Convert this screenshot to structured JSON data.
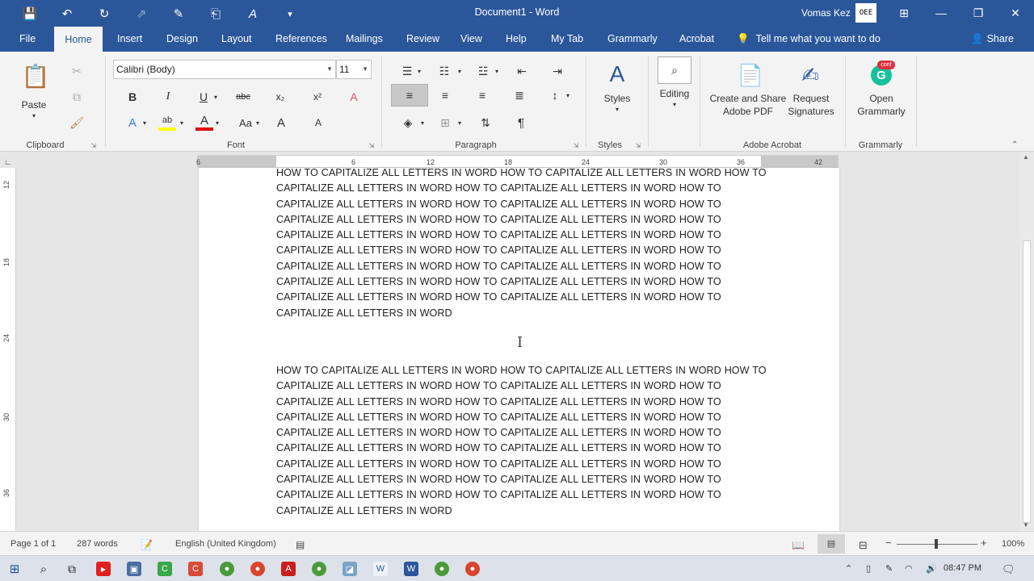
{
  "titlebar": {
    "doc_title": "Document1  -  Word",
    "user_name": "Vomas Kez",
    "avatar_text": "OEE",
    "qat_icons": [
      "save-icon",
      "undo-icon",
      "redo-icon",
      "touch-mode-icon",
      "form-icon",
      "page-icon",
      "font-color-icon",
      "customize-icon"
    ],
    "qat_glyphs": [
      "💾",
      "↶",
      "↻",
      "⇗",
      "✎",
      "⎗",
      "A",
      "▾"
    ],
    "controls": {
      "restore_ribbon": "⊞",
      "minimize": "—",
      "maximize": "❐",
      "close": "✕"
    }
  },
  "tabs": [
    {
      "label": "File"
    },
    {
      "label": "Home"
    },
    {
      "label": "Insert"
    },
    {
      "label": "Design"
    },
    {
      "label": "Layout"
    },
    {
      "label": "References"
    },
    {
      "label": "Mailings"
    },
    {
      "label": "Review"
    },
    {
      "label": "View"
    },
    {
      "label": "Help"
    },
    {
      "label": "My Tab"
    },
    {
      "label": "Grammarly"
    },
    {
      "label": "Acrobat"
    }
  ],
  "tellme": "Tell me what you want to do",
  "share": "Share",
  "ribbon": {
    "clipboard": {
      "paste": "Paste",
      "label": "Clipboard"
    },
    "font": {
      "family": "Calibri (Body)",
      "size": "11",
      "label": "Font",
      "bold": "B",
      "italic": "I",
      "underline": "U",
      "strike": "abc",
      "subscript": "x₂",
      "superscript": "x²",
      "clear": "A",
      "text_effects": "A",
      "highlight": "ab",
      "font_color": "A",
      "change_case": "Aa",
      "grow": "A",
      "shrink": "A"
    },
    "paragraph": {
      "label": "Paragraph",
      "show_marks": "¶"
    },
    "styles": {
      "button": "Styles",
      "label": "Styles"
    },
    "editing": {
      "button": "Editing"
    },
    "acrobat": {
      "create_share": "Create and Share",
      "adobe_pdf": "Adobe PDF",
      "request": "Request",
      "signatures": "Signatures",
      "label": "Adobe Acrobat"
    },
    "grammarly": {
      "open": "Open",
      "grammarly": "Grammarly",
      "label": "Grammarly",
      "badge": "conf"
    }
  },
  "ruler": {
    "h_ticks": [
      "6",
      "6",
      "12",
      "18",
      "24",
      "30",
      "36",
      "42"
    ],
    "v_ticks": [
      "12",
      "18",
      "24",
      "30",
      "36"
    ]
  },
  "document": {
    "paragraph_1": "HOW TO CAPITALIZE ALL LETTERS IN WORD  HOW TO CAPITALIZE ALL LETTERS IN WORD HOW TO CAPITALIZE ALL LETTERS IN WORD  HOW TO CAPITALIZE ALL LETTERS IN WORD HOW TO CAPITALIZE ALL LETTERS IN WORD  HOW TO CAPITALIZE ALL LETTERS IN WORD HOW TO CAPITALIZE ALL LETTERS IN WORD  HOW TO CAPITALIZE ALL LETTERS IN WORD HOW TO CAPITALIZE ALL LETTERS IN WORD HOW TO CAPITALIZE ALL LETTERS IN WORD HOW TO CAPITALIZE ALL LETTERS IN WORD  HOW TO CAPITALIZE ALL LETTERS IN WORD HOW TO CAPITALIZE ALL LETTERS IN WORD HOW TO CAPITALIZE ALL LETTERS IN WORD  HOW TO CAPITALIZE ALL LETTERS IN WORD HOW TO CAPITALIZE ALL LETTERS IN WORD  HOW TO CAPITALIZE ALL LETTERS IN WORD HOW TO CAPITALIZE ALL LETTERS IN WORD  HOW TO CAPITALIZE ALL LETTERS IN WORD",
    "paragraph_2": "HOW TO CAPITALIZE ALL LETTERS IN WORD  HOW TO CAPITALIZE ALL LETTERS IN WORD HOW TO CAPITALIZE ALL LETTERS IN WORD  HOW TO CAPITALIZE ALL LETTERS IN WORD HOW TO CAPITALIZE ALL LETTERS IN WORD  HOW TO CAPITALIZE ALL LETTERS IN WORD HOW TO CAPITALIZE ALL LETTERS IN WORD  HOW TO CAPITALIZE ALL LETTERS IN WORD HOW TO CAPITALIZE ALL LETTERS IN WORD HOW TO CAPITALIZE ALL LETTERS IN WORD HOW TO CAPITALIZE ALL LETTERS IN WORD  HOW TO CAPITALIZE ALL LETTERS IN WORD HOW TO CAPITALIZE ALL LETTERS IN WORD HOW TO CAPITALIZE ALL LETTERS IN WORD  HOW TO CAPITALIZE ALL LETTERS IN WORD HOW TO CAPITALIZE ALL LETTERS IN WORD  HOW TO CAPITALIZE ALL LETTERS IN WORD HOW TO CAPITALIZE ALL LETTERS IN WORD  HOW TO CAPITALIZE ALL LETTERS IN WORD"
  },
  "statusbar": {
    "page": "Page 1 of 1",
    "words": "287 words",
    "language": "English (United Kingdom)",
    "zoom": "100%",
    "zoom_minus": "−",
    "zoom_plus": "+"
  },
  "taskbar": {
    "time": "08:47 PM",
    "apps": [
      "windows-start-icon",
      "search-icon",
      "task-view-icon",
      "youtube-icon",
      "app-icon",
      "camtasia-icon",
      "app-red-icon",
      "chrome-icon",
      "chrome-icon",
      "acrobat-icon",
      "chrome-icon",
      "app-icon",
      "word-doc-icon",
      "word-icon",
      "chrome-icon",
      "chrome-icon"
    ]
  },
  "colors": {
    "word_blue": "#2b579a",
    "ribbon_bg": "#f3f3f3",
    "grammarly_green": "#15c39a",
    "highlight_yellow": "#ffff00",
    "font_red": "#e00000"
  }
}
